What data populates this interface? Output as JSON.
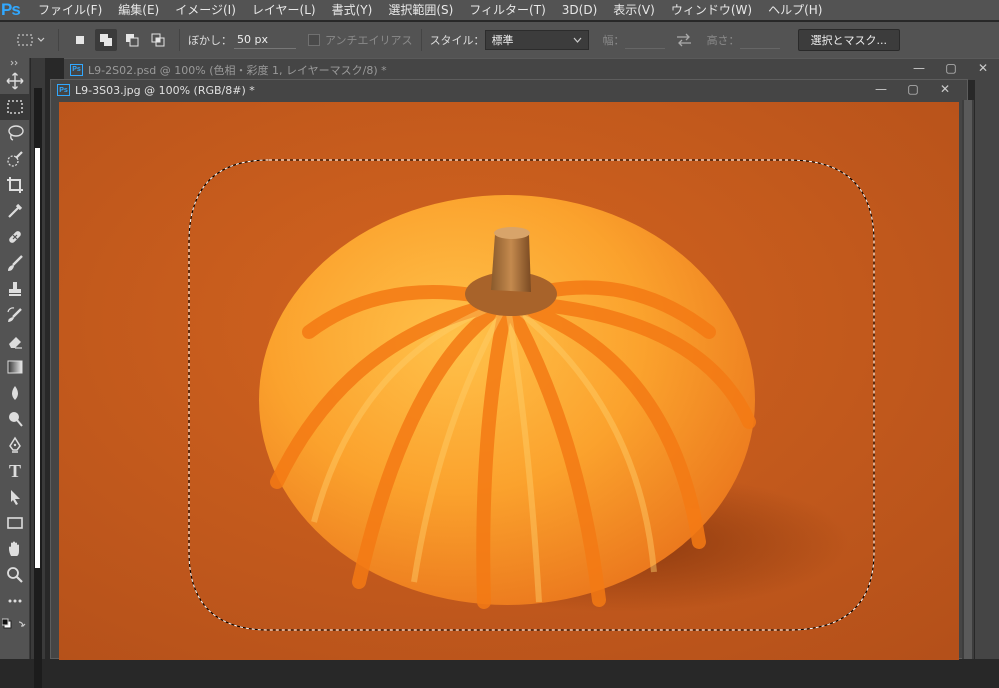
{
  "app": {
    "logo": "Ps"
  },
  "menu": [
    "ファイル(F)",
    "編集(E)",
    "イメージ(I)",
    "レイヤー(L)",
    "書式(Y)",
    "選択範囲(S)",
    "フィルター(T)",
    "3D(D)",
    "表示(V)",
    "ウィンドウ(W)",
    "ヘルプ(H)"
  ],
  "options": {
    "feather_label": "ぼかし：",
    "feather_value": "50 px",
    "antialias_label": "アンチエイリアス",
    "style_label": "スタイル：",
    "style_value": "標準",
    "width_label": "幅：",
    "height_label": "高さ：",
    "select_mask_label": "選択とマスク..."
  },
  "documents": {
    "back": {
      "badge": "Ps",
      "title": "L9-2S02.psd @ 100% (色相・彩度 1, レイヤーマスク/8) *"
    },
    "front": {
      "badge": "Ps",
      "title": "L9-3S03.jpg @ 100% (RGB/8#) *"
    }
  },
  "window_buttons": {
    "minimize": "—",
    "maximize": "▢",
    "close": "✕"
  },
  "tools": [
    "move-icon",
    "rectangular-marquee-icon",
    "lasso-icon",
    "quick-selection-icon",
    "crop-icon",
    "eyedropper-icon",
    "healing-brush-icon",
    "brush-icon",
    "clone-stamp-icon",
    "history-brush-icon",
    "eraser-icon",
    "gradient-icon",
    "blur-icon",
    "dodge-icon",
    "pen-icon",
    "type-icon",
    "path-selection-icon",
    "rectangle-icon",
    "hand-icon",
    "zoom-icon",
    "more-tools-icon"
  ],
  "type_tool_glyph": "T",
  "colors": {
    "ui_bg": "#535353",
    "canvas_bg": "#c65a1c",
    "ps_blue": "#31a8ff"
  }
}
